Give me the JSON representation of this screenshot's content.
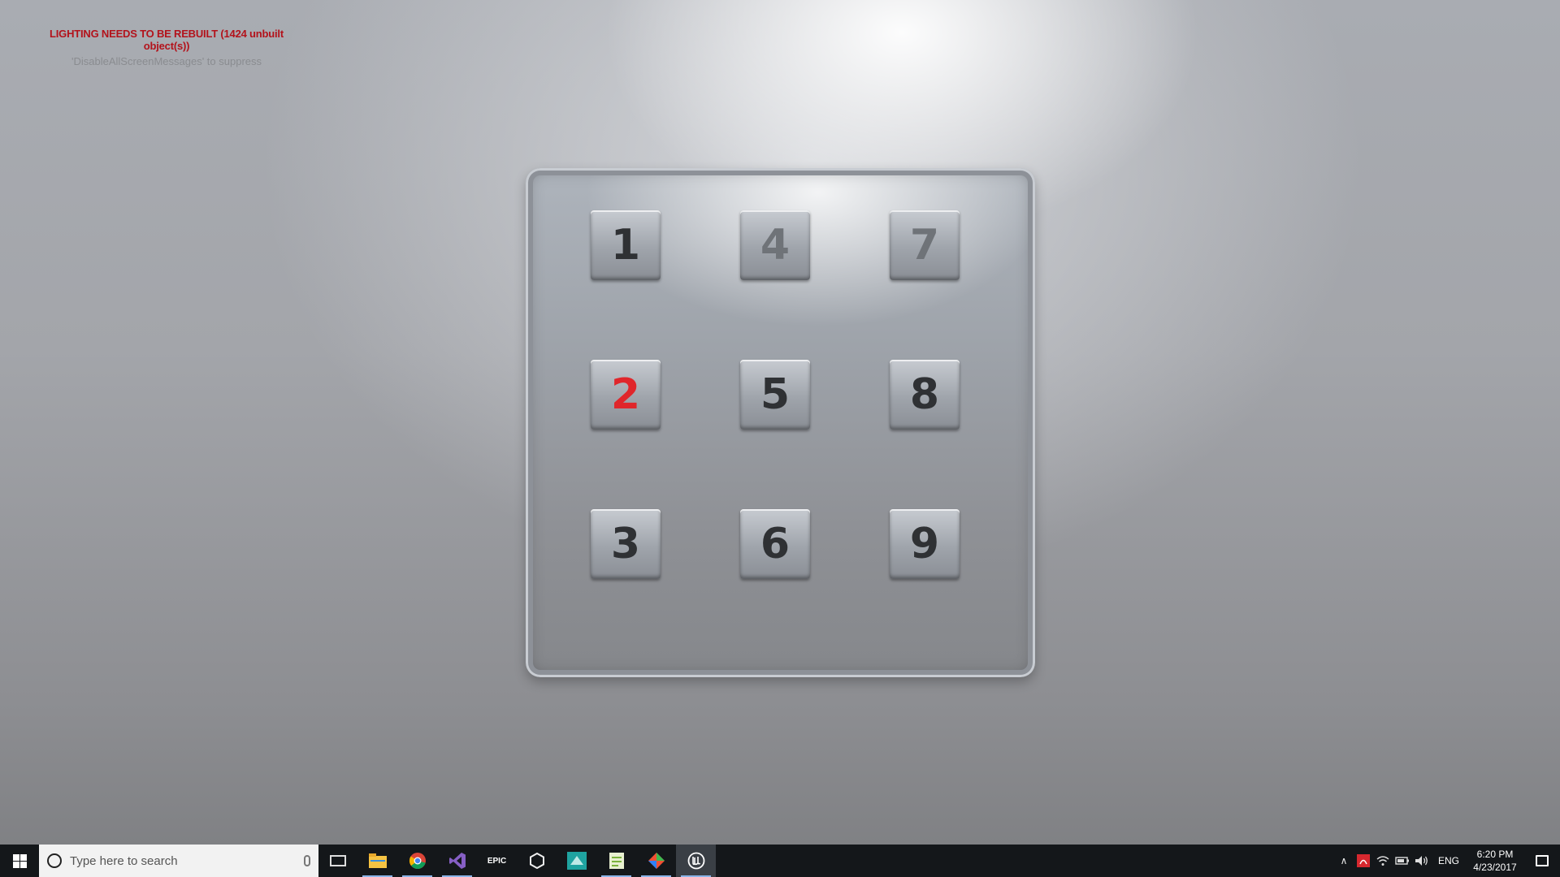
{
  "engine_messages": {
    "warning": "LIGHTING NEEDS TO BE REBUILT (1424 unbuilt object(s))",
    "hint": "'DisableAllScreenMessages' to suppress",
    "warning_color": "#b3121b"
  },
  "keypad": {
    "keys": [
      {
        "label": "1",
        "state": "normal"
      },
      {
        "label": "4",
        "state": "faded"
      },
      {
        "label": "7",
        "state": "faded"
      },
      {
        "label": "2",
        "state": "active"
      },
      {
        "label": "5",
        "state": "normal"
      },
      {
        "label": "8",
        "state": "normal"
      },
      {
        "label": "3",
        "state": "normal"
      },
      {
        "label": "6",
        "state": "normal"
      },
      {
        "label": "9",
        "state": "normal"
      }
    ],
    "active_color": "#e0262b"
  },
  "taskbar": {
    "search_placeholder": "Type here to search",
    "apps": [
      {
        "icon": "file-explorer-icon",
        "running": true
      },
      {
        "icon": "chrome-icon",
        "running": true
      },
      {
        "icon": "visual-studio-icon",
        "running": true
      },
      {
        "icon": "epic-games-icon",
        "label": "EPIC",
        "running": false
      },
      {
        "icon": "unity-icon",
        "running": false
      },
      {
        "icon": "app-icon",
        "running": false
      },
      {
        "icon": "notepad-icon",
        "running": true
      },
      {
        "icon": "git-icon",
        "running": true
      },
      {
        "icon": "unreal-engine-icon",
        "running": true,
        "focused": true
      }
    ],
    "tray": {
      "language": "ENG",
      "time": "6:20 PM",
      "date": "4/23/2017"
    }
  }
}
